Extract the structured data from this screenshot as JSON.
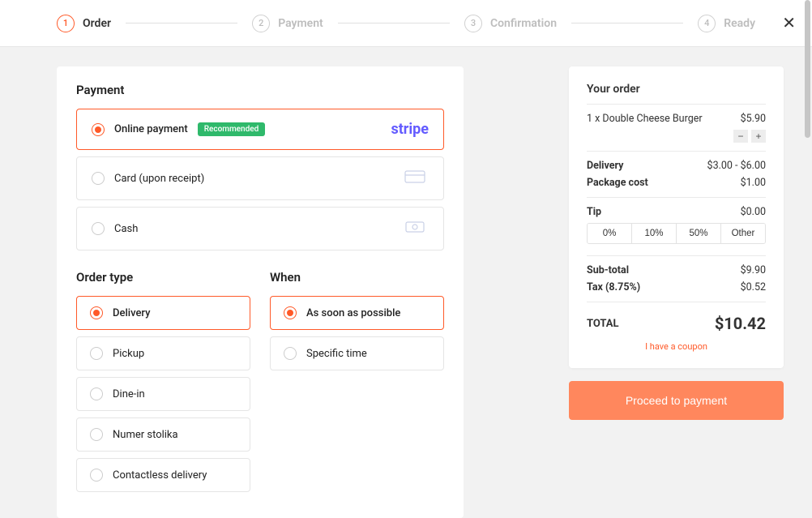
{
  "steps": [
    {
      "num": "1",
      "label": "Order",
      "active": true
    },
    {
      "num": "2",
      "label": "Payment",
      "active": false
    },
    {
      "num": "3",
      "label": "Confirmation",
      "active": false
    },
    {
      "num": "4",
      "label": "Ready",
      "active": false
    }
  ],
  "payment": {
    "title": "Payment",
    "options": [
      {
        "label": "Online payment",
        "badge": "Recommended",
        "brand": "stripe",
        "selected": true
      },
      {
        "label": "Card (upon receipt)",
        "icon": "card",
        "selected": false
      },
      {
        "label": "Cash",
        "icon": "cash",
        "selected": false
      }
    ]
  },
  "order_type": {
    "title": "Order type",
    "options": [
      {
        "label": "Delivery",
        "selected": true
      },
      {
        "label": "Pickup",
        "selected": false
      },
      {
        "label": "Dine-in",
        "selected": false
      },
      {
        "label": "Numer stolika",
        "selected": false
      },
      {
        "label": "Contactless delivery",
        "selected": false
      }
    ]
  },
  "when": {
    "title": "When",
    "options": [
      {
        "label": "As soon as possible",
        "selected": true
      },
      {
        "label": "Specific time",
        "selected": false
      }
    ]
  },
  "summary": {
    "title": "Your order",
    "item": {
      "qty_label": "1 x Double Cheese Burger",
      "price": "$5.90"
    },
    "delivery": {
      "label": "Delivery",
      "value": "$3.00 - $6.00"
    },
    "package": {
      "label": "Package cost",
      "value": "$1.00"
    },
    "tip": {
      "label": "Tip",
      "value": "$0.00",
      "options": [
        "0%",
        "10%",
        "50%",
        "Other"
      ]
    },
    "subtotal": {
      "label": "Sub-total",
      "value": "$9.90"
    },
    "tax": {
      "label": "Tax (8.75%)",
      "value": "$0.52"
    },
    "total": {
      "label": "TOTAL",
      "value": "$10.42"
    },
    "coupon": "I have a coupon",
    "proceed": "Proceed to payment"
  }
}
